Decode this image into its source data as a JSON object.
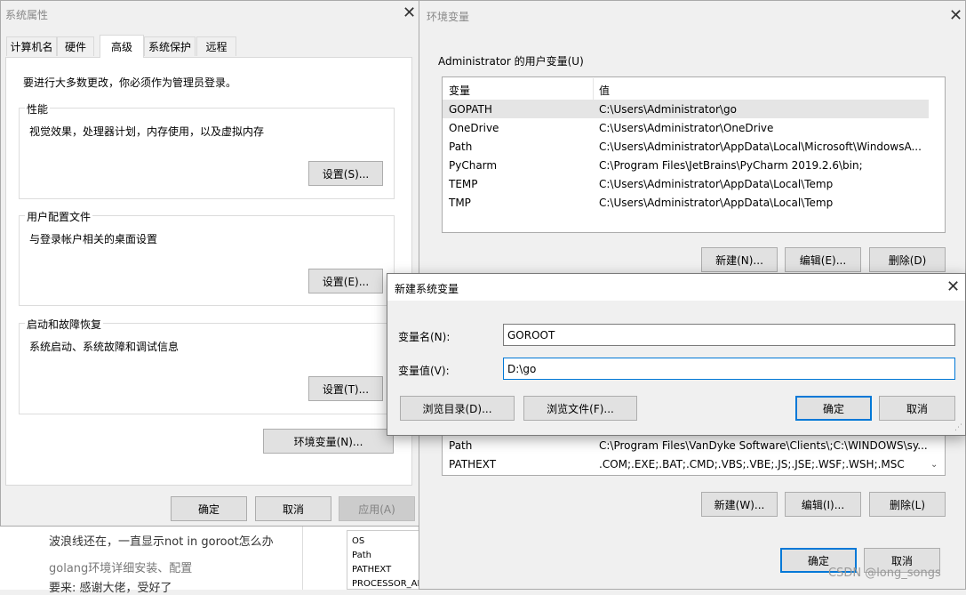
{
  "sysprops": {
    "title": "系统属性",
    "tabs": [
      "计算机名",
      "硬件",
      "高级",
      "系统保护",
      "远程"
    ],
    "admin_note": "要进行大多数更改，你必须作为管理员登录。",
    "perf": {
      "label": "性能",
      "desc": "视觉效果，处理器计划，内存使用，以及虚拟内存",
      "button": "设置(S)..."
    },
    "profile": {
      "label": "用户配置文件",
      "desc": "与登录帐户相关的桌面设置",
      "button": "设置(E)..."
    },
    "startup": {
      "label": "启动和故障恢复",
      "desc": "系统启动、系统故障和调试信息",
      "button": "设置(T)..."
    },
    "env_button": "环境变量(N)...",
    "ok": "确定",
    "cancel": "取消",
    "apply": "应用(A)"
  },
  "envvars": {
    "title": "环境变量",
    "user_group": "Administrator 的用户变量(U)",
    "col_var": "变量",
    "col_val": "值",
    "user_rows": [
      {
        "name": "GOPATH",
        "value": "C:\\Users\\Administrator\\go"
      },
      {
        "name": "OneDrive",
        "value": "C:\\Users\\Administrator\\OneDrive"
      },
      {
        "name": "Path",
        "value": "C:\\Users\\Administrator\\AppData\\Local\\Microsoft\\WindowsA..."
      },
      {
        "name": "PyCharm",
        "value": "C:\\Program Files\\JetBrains\\PyCharm 2019.2.6\\bin;"
      },
      {
        "name": "TEMP",
        "value": "C:\\Users\\Administrator\\AppData\\Local\\Temp"
      },
      {
        "name": "TMP",
        "value": "C:\\Users\\Administrator\\AppData\\Local\\Temp"
      }
    ],
    "user_new": "新建(N)...",
    "user_edit": "编辑(E)...",
    "user_delete": "删除(D)",
    "sys_rows": [
      {
        "name": "Path",
        "value": "C:\\Program Files\\VanDyke Software\\Clients\\;C:\\WINDOWS\\sy..."
      },
      {
        "name": "PATHEXT",
        "value": ".COM;.EXE;.BAT;.CMD;.VBS;.VBE;.JS;.JSE;.WSF;.WSH;.MSC"
      }
    ],
    "sys_new": "新建(W)...",
    "sys_edit": "编辑(I)...",
    "sys_delete": "删除(L)",
    "ok": "确定",
    "cancel": "取消"
  },
  "newvar": {
    "title": "新建系统变量",
    "name_label": "变量名(N):",
    "name_value": "GOROOT",
    "value_label": "变量值(V):",
    "value_value": "D:\\go",
    "browse_dir": "浏览目录(D)...",
    "browse_file": "浏览文件(F)...",
    "ok": "确定",
    "cancel": "取消"
  },
  "background": {
    "line1": "波浪线还在，一直显示not in goroot怎么办",
    "line2": "golang环境详细安装、配置",
    "line3": "要来: 感谢大佬，受好了",
    "list": [
      "OS",
      "Path",
      "PATHEXT",
      "PROCESSOR_AR"
    ]
  },
  "watermark": "CSDN @long_songs"
}
